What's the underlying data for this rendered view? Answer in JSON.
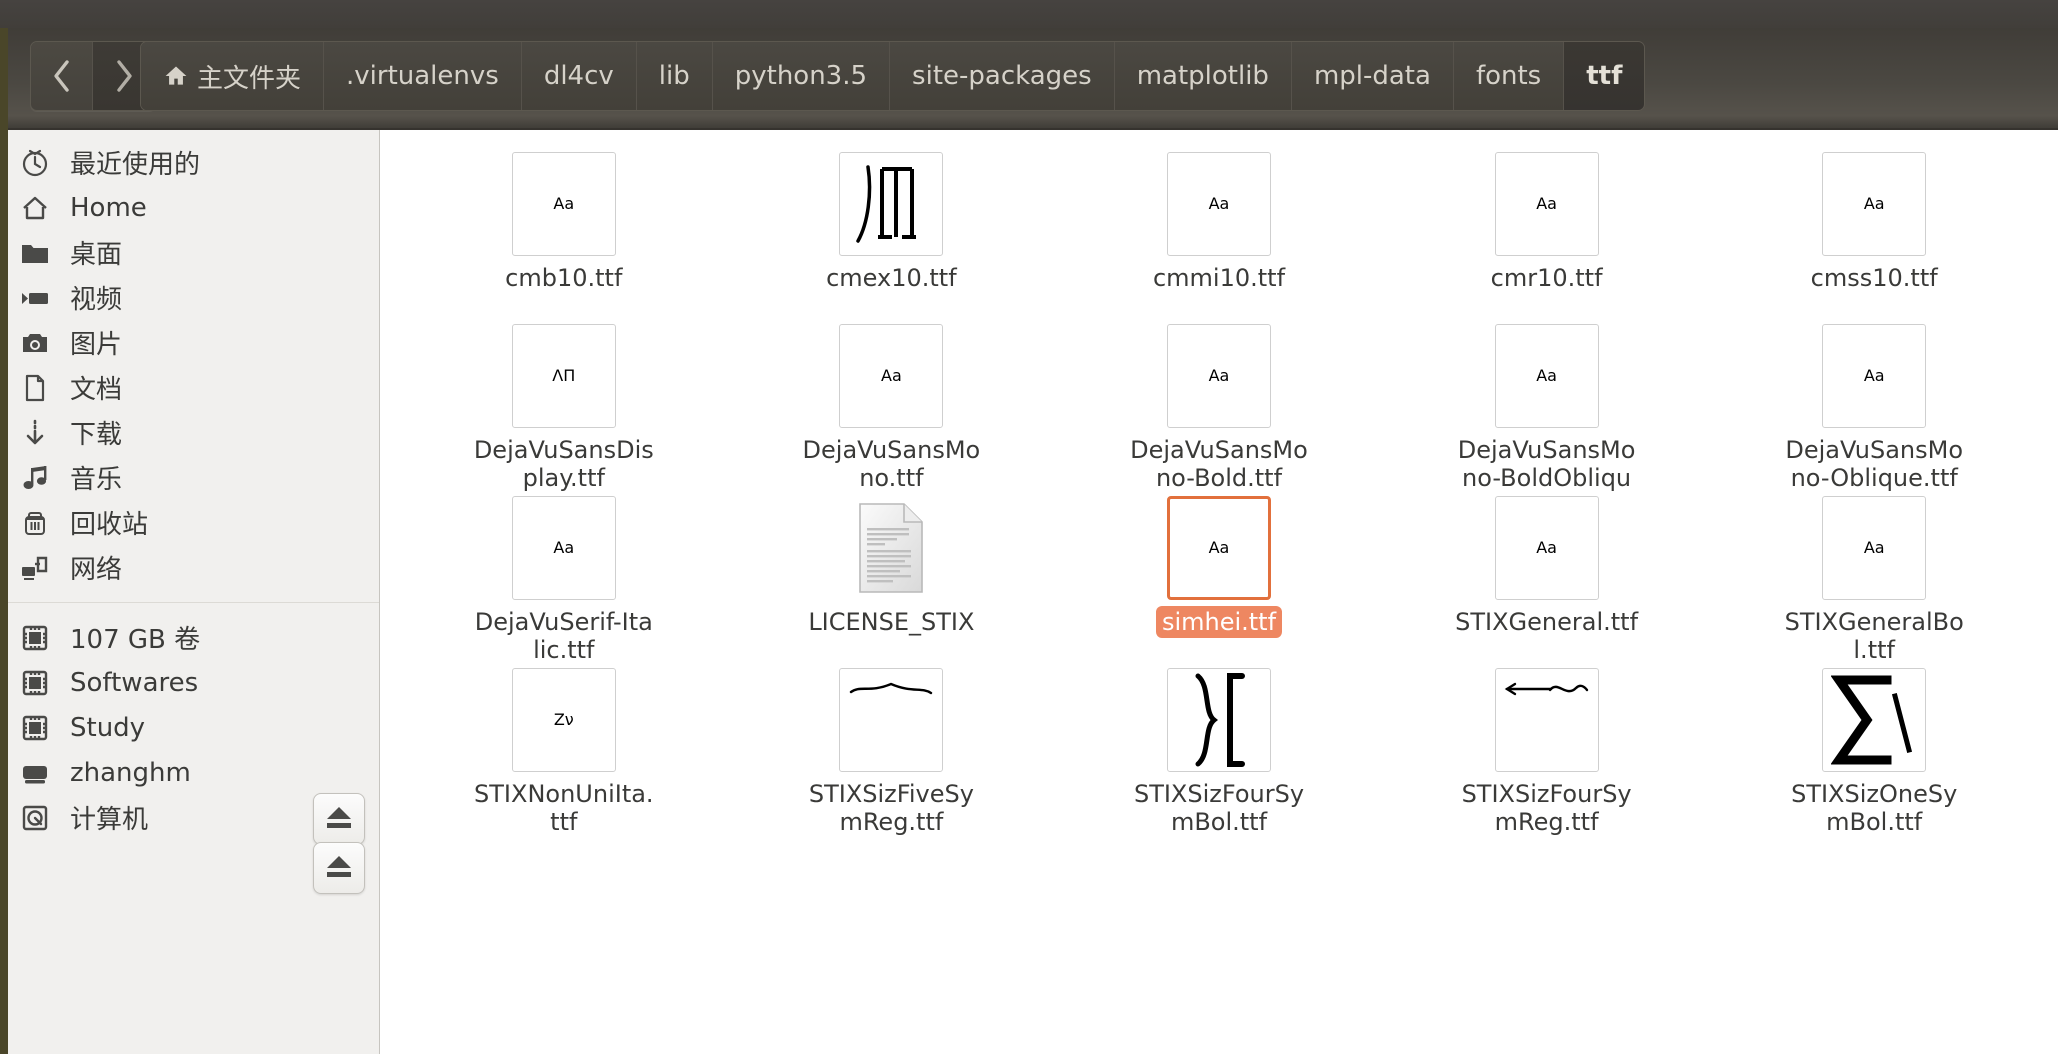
{
  "header": {
    "nav": {
      "back_label": "‹",
      "forward_label": "›",
      "back_name": "back-button",
      "forward_name": "forward-button"
    },
    "breadcrumbs": [
      {
        "label": "主文件夹",
        "icon": "home-icon",
        "active": false
      },
      {
        "label": ".virtualenvs",
        "icon": "",
        "active": false
      },
      {
        "label": "dl4cv",
        "icon": "",
        "active": false
      },
      {
        "label": "lib",
        "icon": "",
        "active": false
      },
      {
        "label": "python3.5",
        "icon": "",
        "active": false
      },
      {
        "label": "site-packages",
        "icon": "",
        "active": false
      },
      {
        "label": "matplotlib",
        "icon": "",
        "active": false
      },
      {
        "label": "mpl-data",
        "icon": "",
        "active": false
      },
      {
        "label": "fonts",
        "icon": "",
        "active": false
      },
      {
        "label": "ttf",
        "icon": "",
        "active": true
      }
    ]
  },
  "sidebar": {
    "places": [
      {
        "label": "最近使用的",
        "icon": "clock-icon"
      },
      {
        "label": "Home",
        "icon": "home-icon"
      },
      {
        "label": "桌面",
        "icon": "folder-icon"
      },
      {
        "label": "视频",
        "icon": "video-icon"
      },
      {
        "label": "图片",
        "icon": "camera-icon"
      },
      {
        "label": "文档",
        "icon": "document-icon"
      },
      {
        "label": "下载",
        "icon": "download-icon"
      },
      {
        "label": "音乐",
        "icon": "music-icon"
      },
      {
        "label": "回收站",
        "icon": "trash-icon"
      },
      {
        "label": "网络",
        "icon": "network-icon"
      }
    ],
    "devices": [
      {
        "label": "107 GB 卷",
        "icon": "drive-icon",
        "eject": false
      },
      {
        "label": "Softwares",
        "icon": "drive-icon",
        "eject": false
      },
      {
        "label": "Study",
        "icon": "drive-icon",
        "eject": true
      },
      {
        "label": "zhanghm",
        "icon": "harddisk-icon",
        "eject": true
      },
      {
        "label": "计算机",
        "icon": "computer-icon",
        "eject": false
      }
    ],
    "eject_buttons": [
      "eject-button-study",
      "eject-button-zhanghm"
    ]
  },
  "files": [
    {
      "name": "cmb10.ttf",
      "preview": "Aa",
      "style": "serif-bold",
      "selected": false
    },
    {
      "name": "cmex10.ttf",
      "preview": "ʖⅠⅠ",
      "style": "symbol-cmex",
      "selected": false
    },
    {
      "name": "cmmi10.ttf",
      "preview": "Aa",
      "style": "serif-italic",
      "selected": false
    },
    {
      "name": "cmr10.ttf",
      "preview": "Aa",
      "style": "serif",
      "selected": false
    },
    {
      "name": "cmss10.ttf",
      "preview": "Aa",
      "style": "sans",
      "selected": false
    },
    {
      "name": "DejaVuSansDisplay.ttf",
      "preview": "ΛΠ",
      "style": "sans-caps",
      "selected": false
    },
    {
      "name": "DejaVuSansMono.ttf",
      "preview": "Aa",
      "style": "mono",
      "selected": false
    },
    {
      "name": "DejaVuSansMono-Bold.ttf",
      "preview": "Aa",
      "style": "mono-bold",
      "selected": false
    },
    {
      "name": "DejaVuSansMono-BoldOblique.ttf",
      "preview": "Aa",
      "style": "mono-bold-italic",
      "selected": false
    },
    {
      "name": "DejaVuSansMono-Oblique.ttf",
      "preview": "Aa",
      "style": "mono-italic",
      "selected": false
    },
    {
      "name": "DejaVuSerif-Italic.ttf",
      "preview": "Aa",
      "style": "serif-italic-dv",
      "selected": false
    },
    {
      "name": "LICENSE_STIX",
      "preview": "",
      "style": "text-document",
      "selected": false
    },
    {
      "name": "simhei.ttf",
      "preview": "Aa",
      "style": "sans-hei",
      "selected": true
    },
    {
      "name": "STIXGeneral.ttf",
      "preview": "Aa",
      "style": "serif",
      "selected": false
    },
    {
      "name": "STIXGeneralBol.ttf",
      "preview": "Aa",
      "style": "serif-bold",
      "selected": false
    },
    {
      "name": "STIXNonUniIta.ttf",
      "preview": "Zν",
      "style": "sans-bold-italic",
      "selected": false
    },
    {
      "name": "STIXSizFiveSymReg.ttf",
      "preview": "",
      "style": "symbol-widehat",
      "selected": false
    },
    {
      "name": "STIXSizFourSymBol.ttf",
      "preview": "}[",
      "style": "symbol-brackets",
      "selected": false
    },
    {
      "name": "STIXSizFourSymReg.ttf",
      "preview": "",
      "style": "symbol-arrowtilde",
      "selected": false
    },
    {
      "name": "STIXSizOneSymBol.ttf",
      "preview": "∑\\",
      "style": "symbol-sigma",
      "selected": false
    }
  ],
  "colors": {
    "header_bg": "#46433D",
    "sidebar_bg": "#F1F0EE",
    "content_bg": "#FFFFFF",
    "selection_label_bg": "#EE8761",
    "selection_border": "#E2703C",
    "selection_text": "#FFFFFF",
    "text_primary": "#3A3A38",
    "header_text": "#D6D2C9",
    "desktop_strip": "#4A4629"
  }
}
